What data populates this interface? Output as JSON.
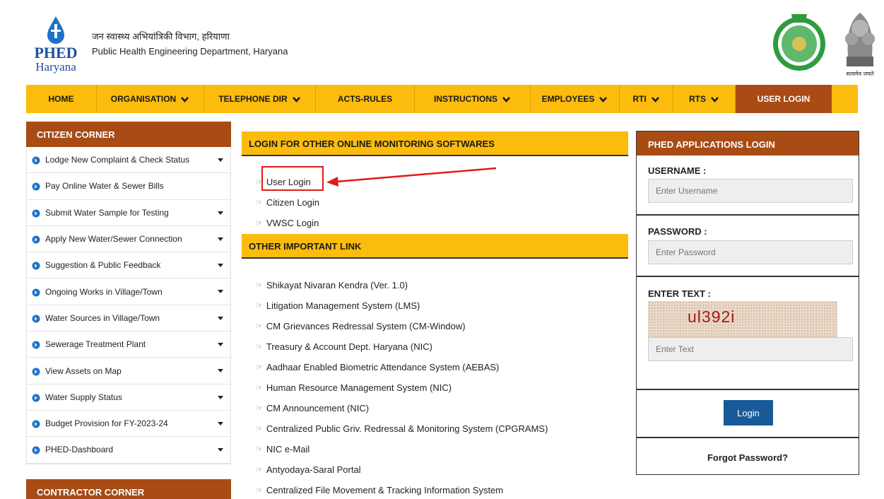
{
  "header": {
    "logo_text": "PHED",
    "logo_subtext": "Haryana",
    "dept_hindi": "जन स्वास्थ्य अभियांत्रिकी विभाग, हरियाणा",
    "dept_english": "Public Health Engineering Department, Haryana",
    "emblem_text": "सत्यमेव जयते"
  },
  "nav": [
    {
      "label": "HOME",
      "dropdown": false
    },
    {
      "label": "ORGANISATION",
      "dropdown": true
    },
    {
      "label": "TELEPHONE DIR",
      "dropdown": true
    },
    {
      "label": "ACTS-RULES",
      "dropdown": false
    },
    {
      "label": "INSTRUCTIONS",
      "dropdown": true
    },
    {
      "label": "EMPLOYEES",
      "dropdown": true
    },
    {
      "label": "RTI",
      "dropdown": true
    },
    {
      "label": "RTS",
      "dropdown": true
    },
    {
      "label": "USER LOGIN",
      "dropdown": false,
      "active": true
    }
  ],
  "citizen_corner": {
    "title": "CITIZEN CORNER",
    "items": [
      {
        "label": "Lodge New Complaint & Check Status",
        "dropdown": true
      },
      {
        "label": "Pay Online Water & Sewer Bills",
        "dropdown": false
      },
      {
        "label": "Submit Water Sample for Testing",
        "dropdown": true
      },
      {
        "label": "Apply New Water/Sewer Connection",
        "dropdown": true
      },
      {
        "label": "Suggestion & Public Feedback",
        "dropdown": true
      },
      {
        "label": "Ongoing Works in Village/Town",
        "dropdown": true
      },
      {
        "label": "Water Sources in Village/Town",
        "dropdown": true
      },
      {
        "label": "Sewerage Treatment Plant",
        "dropdown": true
      },
      {
        "label": "View Assets on Map",
        "dropdown": true
      },
      {
        "label": "Water Supply Status",
        "dropdown": true
      },
      {
        "label": "Budget Provision for FY-2023-24",
        "dropdown": true
      },
      {
        "label": "PHED-Dashboard",
        "dropdown": true
      }
    ]
  },
  "contractor_corner": {
    "title": "CONTRACTOR CORNER"
  },
  "online_monitoring": {
    "title": "LOGIN FOR OTHER ONLINE MONITORING SOFTWARES",
    "links": [
      "User Login",
      "Citizen Login",
      "VWSC Login"
    ]
  },
  "important_links": {
    "title": "OTHER IMPORTANT LINK",
    "links": [
      "Shikayat Nivaran Kendra (Ver. 1.0)",
      "Litigation Management System (LMS)",
      "CM Grievances Redressal System (CM-Window)",
      "Treasury & Account Dept. Haryana (NIC)",
      "Aadhaar Enabled Biometric Attendance System (AEBAS)",
      "Human Resource Management System (NIC)",
      "CM Announcement (NIC)",
      "Centralized Public Griv. Redressal & Monitoring System (CPGRAMS)",
      "NIC e-Mail",
      "Antyodaya-Saral Portal",
      "Centralized File Movement & Tracking Information System"
    ]
  },
  "login_panel": {
    "title": "PHED APPLICATIONS LOGIN",
    "username_label": "USERNAME :",
    "username_placeholder": "Enter Username",
    "password_label": "PASSWORD :",
    "password_placeholder": "Enter Password",
    "captcha_label": "ENTER TEXT :",
    "captcha_text": "ul392i",
    "captcha_placeholder": "Enter Text",
    "login_button": "Login",
    "forgot_password": "Forgot Password?"
  },
  "colors": {
    "nav_bg": "#fbbc0d",
    "brown": "#a84b14",
    "login_blue": "#175a97",
    "highlight_red": "#e11a1a"
  }
}
